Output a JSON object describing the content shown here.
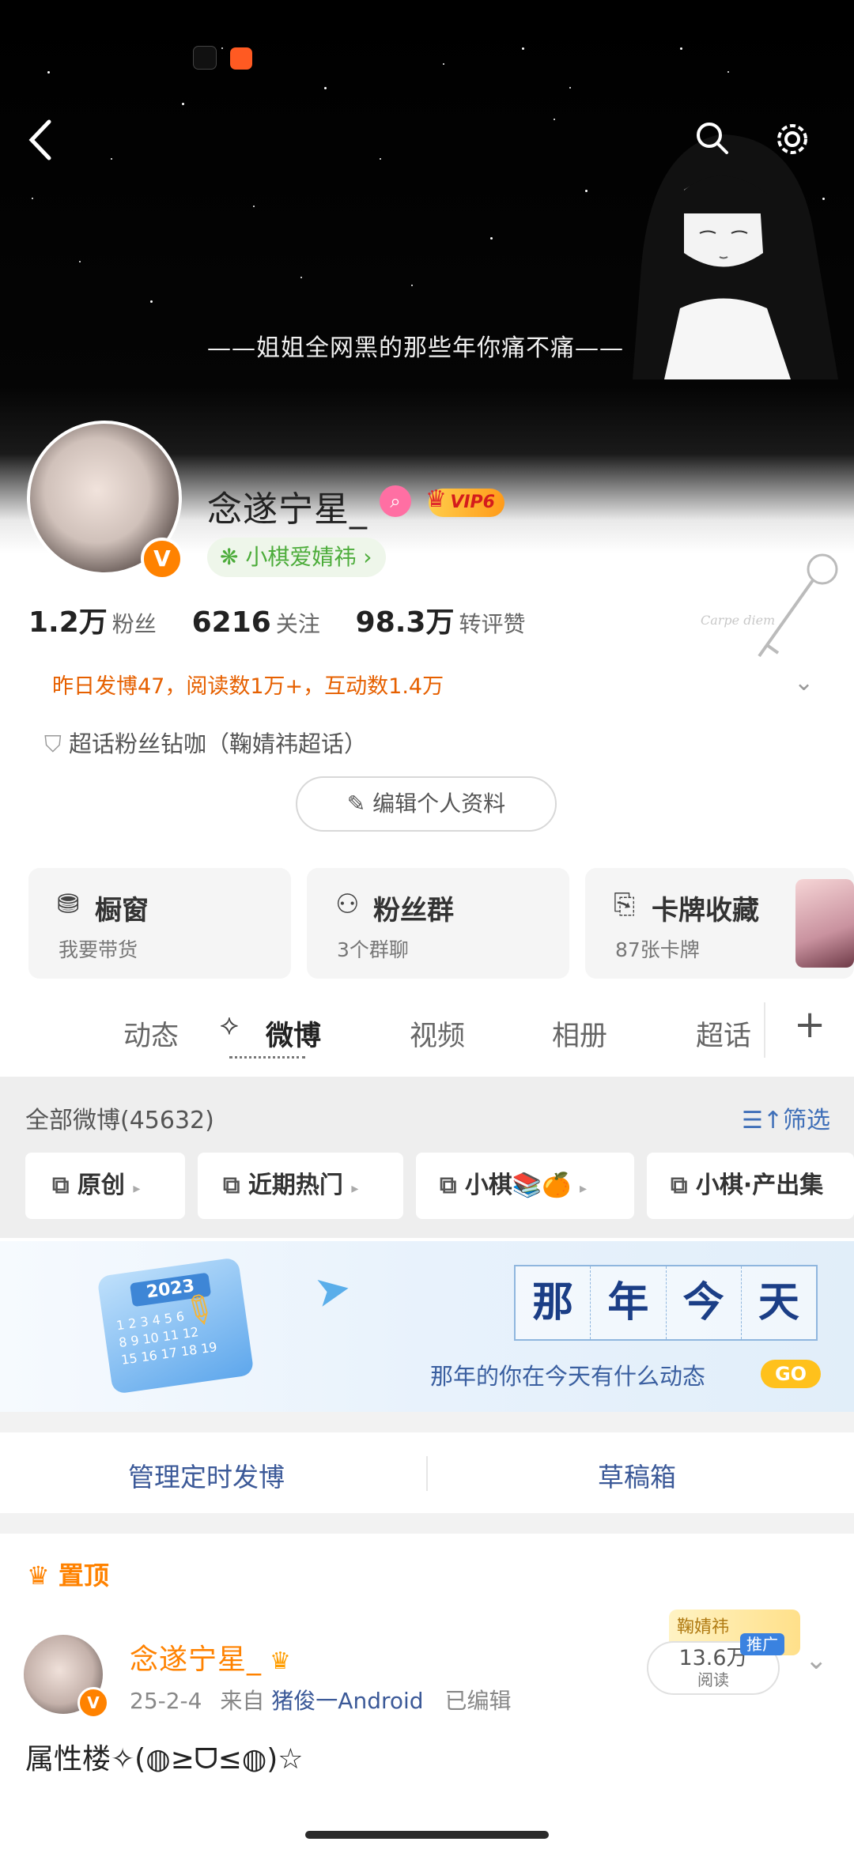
{
  "banner": {
    "text": "——姐姐全网黑的那些年你痛不痛——"
  },
  "profile": {
    "username": "念遂宁星_",
    "vip_label": "VIP6",
    "v_badge": "V",
    "supertopic_tag": "小棋爱婧祎 ›",
    "stats": [
      {
        "value": "1.2万",
        "label": "粉丝"
      },
      {
        "value": "6216",
        "label": "关注"
      },
      {
        "value": "98.3万",
        "label": "转评赞"
      }
    ],
    "yesterday_summary": "昨日发博47，阅读数1万+，互动数1.4万",
    "fan_rank": "超话粉丝钻咖（鞠婧祎超话）",
    "edit_button": "编辑个人资料"
  },
  "cards": [
    {
      "title": "橱窗",
      "subtitle": "我要带货"
    },
    {
      "title": "粉丝群",
      "subtitle": "3个群聊"
    },
    {
      "title": "卡牌收藏",
      "subtitle": "87张卡牌"
    }
  ],
  "tabs": [
    "动态",
    "微博",
    "视频",
    "相册",
    "超话"
  ],
  "tab_plus": "+",
  "feed_header": {
    "all_weibo": "全部微博(45632)",
    "filter": "筛选"
  },
  "chips": [
    "原创",
    "近期热门",
    "小棋📚🍊",
    "小棋·产出集"
  ],
  "promo": {
    "year": "2023",
    "chars": [
      "那",
      "年",
      "今",
      "天"
    ],
    "subtitle": "那年的你在今天有什么动态",
    "go": "GO"
  },
  "manage": {
    "scheduled": "管理定时发博",
    "drafts": "草稿箱"
  },
  "post": {
    "pinned": "置顶",
    "author": "念遂宁星_",
    "date": "25-2-4",
    "from_label": "来自",
    "source": "猪俊一Android",
    "edited": "已编辑",
    "reads_value": "13.6万",
    "reads_label": "阅读",
    "promo_badge": "推广",
    "sticker_text": "鞠婧祎",
    "text": "属性楼✧(◍≥ᗜ≤◍)☆"
  }
}
